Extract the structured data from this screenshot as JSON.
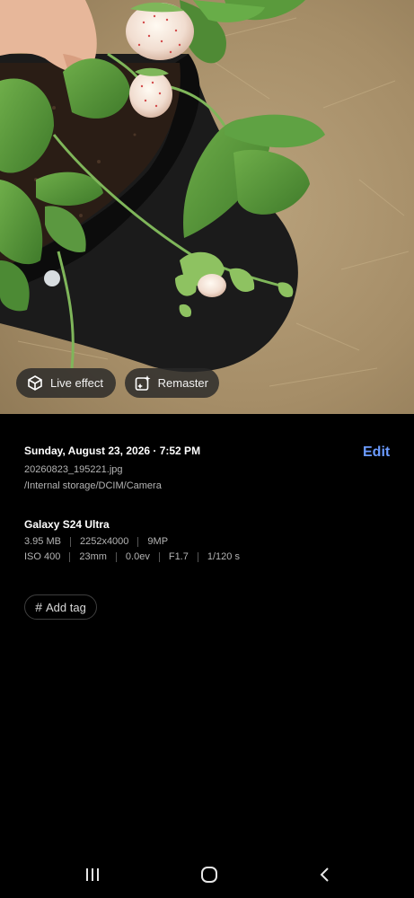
{
  "photo": {
    "subject": "strawberry-plant-photo",
    "chips": {
      "live_effect": "Live effect",
      "remaster": "Remaster"
    }
  },
  "details": {
    "date_time": "Sunday, August 23, 2026 · 7:52 PM",
    "edit_label": "Edit",
    "file_name": "20260823_195221.jpg",
    "path": "/Internal storage/DCIM/Camera",
    "device": "Galaxy S24 Ultra",
    "specs_row1": [
      "3.95 MB",
      "2252x4000",
      "9MP"
    ],
    "specs_row2": [
      "ISO 400",
      "23mm",
      "0.0ev",
      "F1.7",
      "1/120 s"
    ],
    "add_tag_label": "Add tag"
  },
  "colors": {
    "accent": "#6b9bff",
    "background": "#000000",
    "secondary_text": "#b4b4b4"
  },
  "navigation": {
    "icons": [
      "recent-apps-icon",
      "home-icon",
      "back-icon"
    ]
  }
}
